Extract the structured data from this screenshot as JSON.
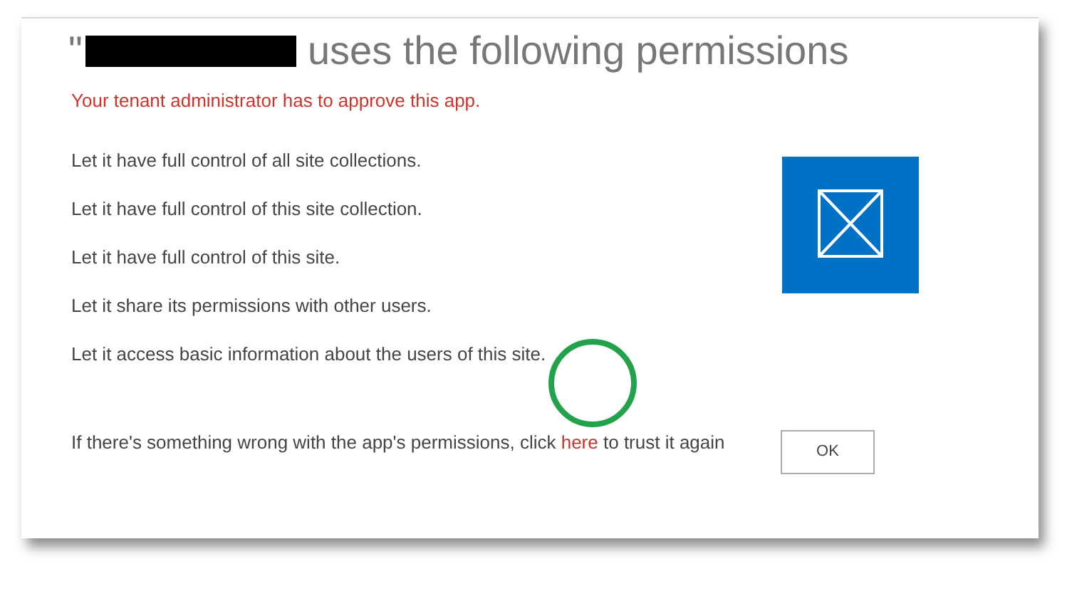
{
  "dialog": {
    "title_start": "\"",
    "title_end": "uses the following permissions",
    "warning": "Your tenant administrator has to approve this app.",
    "permissions": [
      "Let it have full control of all site collections.",
      "Let it have full control of this site collection.",
      "Let it have full control of this site.",
      "Let it share its permissions with other users.",
      "Let it access basic information about the users of this site."
    ],
    "footer_before": "If there's something wrong with the app's permissions, click",
    "footer_link": "here",
    "footer_after": "to trust it again",
    "ok_button": "OK"
  }
}
